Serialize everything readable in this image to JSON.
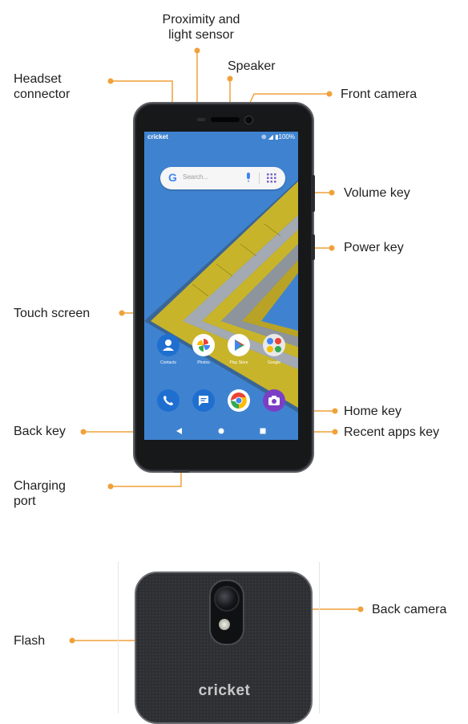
{
  "labels": {
    "proximity": [
      "Proximity and",
      "light sensor"
    ],
    "speaker": "Speaker",
    "headset": [
      "Headset",
      "connector"
    ],
    "front_camera": "Front camera",
    "volume_key": "Volume key",
    "power_key": "Power key",
    "touch_screen": "Touch screen",
    "home_key": "Home key",
    "back_key": "Back key",
    "recent_apps_key": "Recent apps key",
    "charging_port": [
      "Charging",
      "port"
    ],
    "back_camera": "Back camera",
    "flash": "Flash"
  },
  "screen": {
    "carrier": "cricket",
    "status_icons": "⊕ ◢ ▮100%",
    "search_placeholder": "Search...",
    "apps": [
      "Contacts",
      "Photos",
      "Play Store",
      "Google"
    ]
  },
  "back": {
    "brand": "cricket"
  },
  "colors": {
    "callout": "#f0a13a",
    "screen_bg": "#3f83d0",
    "wall_yellow": "#c8b42a"
  }
}
